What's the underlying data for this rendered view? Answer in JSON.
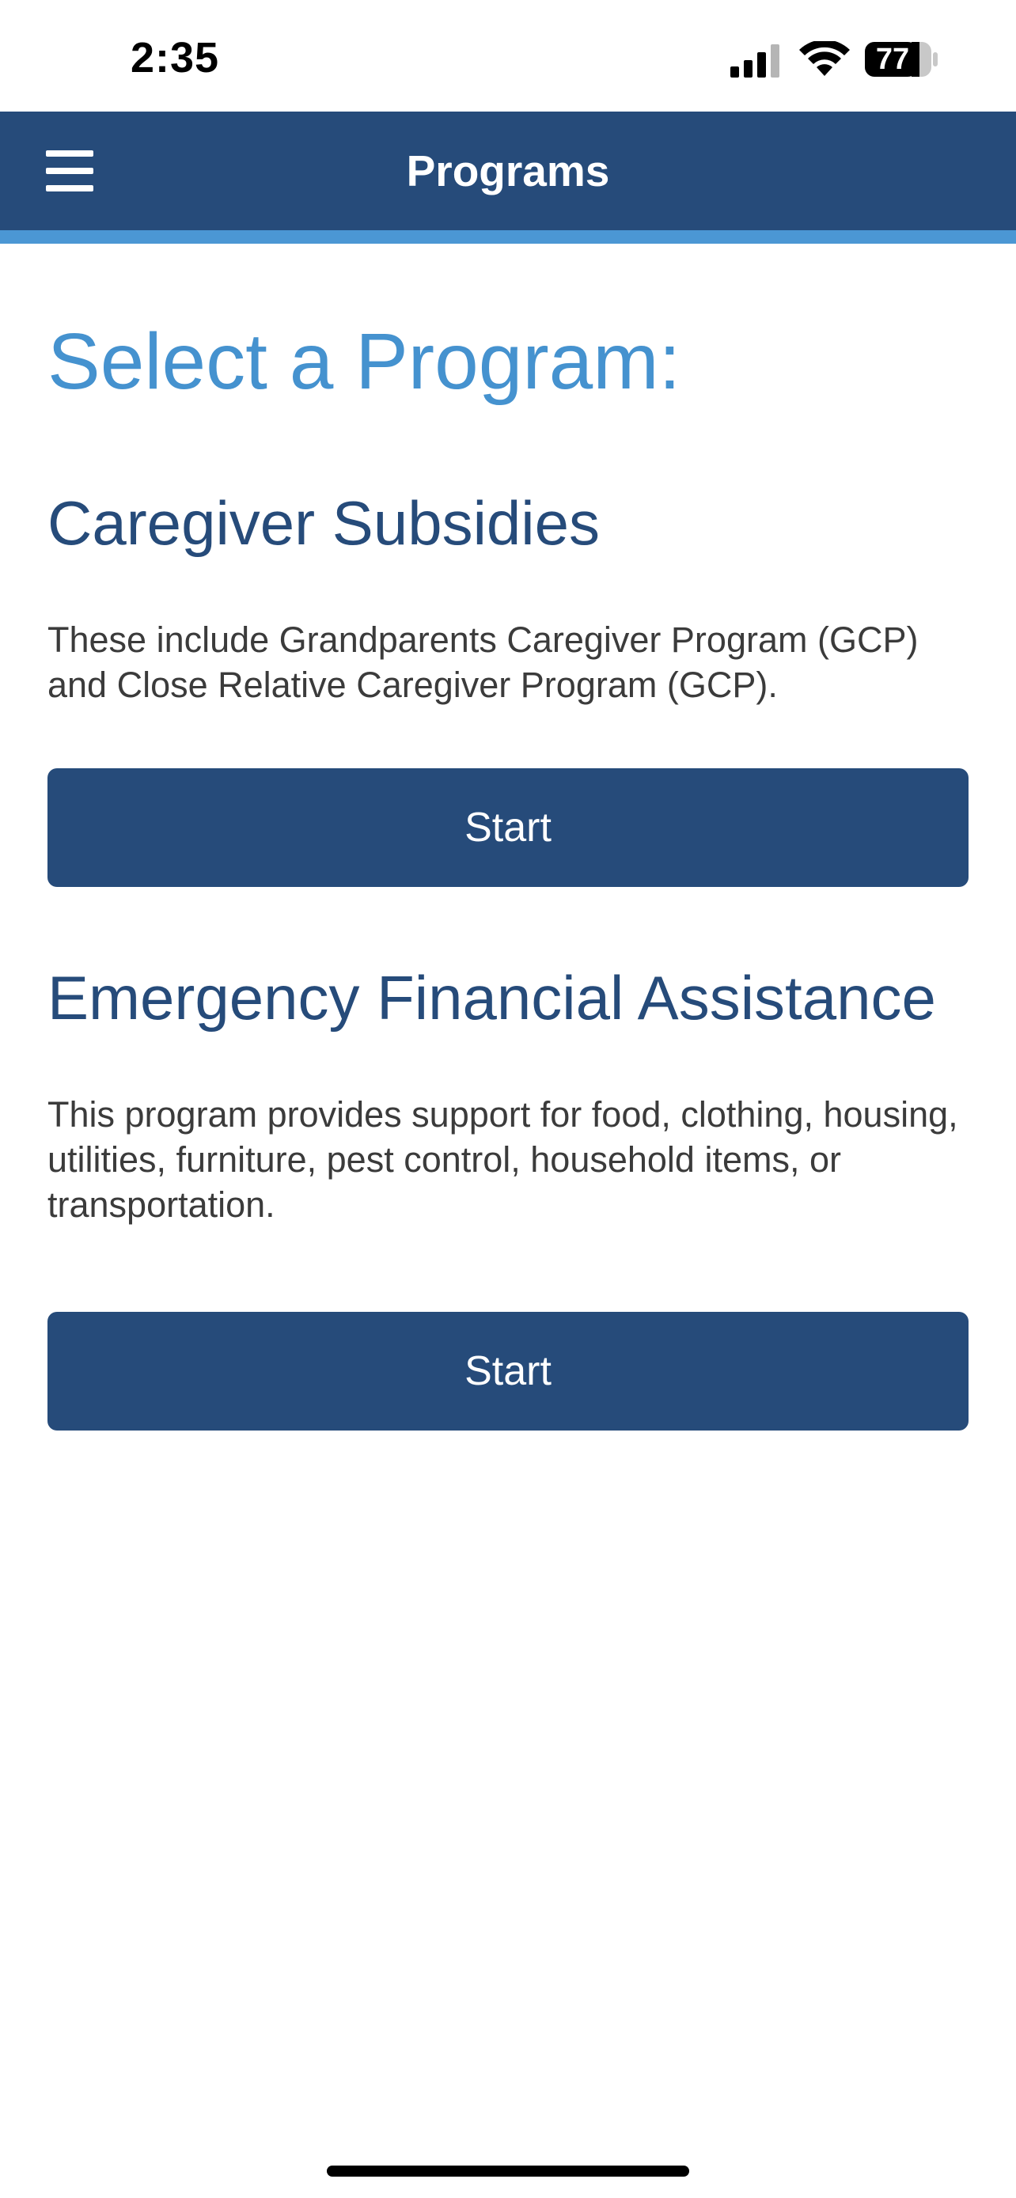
{
  "status_bar": {
    "time": "2:35",
    "battery": "77",
    "icons": [
      "signal-icon",
      "wifi-icon",
      "battery-icon"
    ]
  },
  "nav": {
    "title": "Programs",
    "menu_icon": "hamburger-menu-icon"
  },
  "page": {
    "title": "Select a Program:"
  },
  "programs": [
    {
      "title": "Caregiver Subsidies",
      "description": "These include Grandparents Caregiver Program (GCP) and Close Relative Caregiver Program (GCP).",
      "button_label": "Start"
    },
    {
      "title": "Emergency Financial Assistance",
      "description": "This program provides support for food, clothing, housing, utilities, furniture, pest control, household items, or transportation.",
      "button_label": "Start"
    }
  ],
  "colors": {
    "nav_background": "#264b7a",
    "nav_accent": "#4b97d4",
    "page_title": "#4592cf",
    "section_title": "#264b7a",
    "button_background": "#264b7a"
  }
}
